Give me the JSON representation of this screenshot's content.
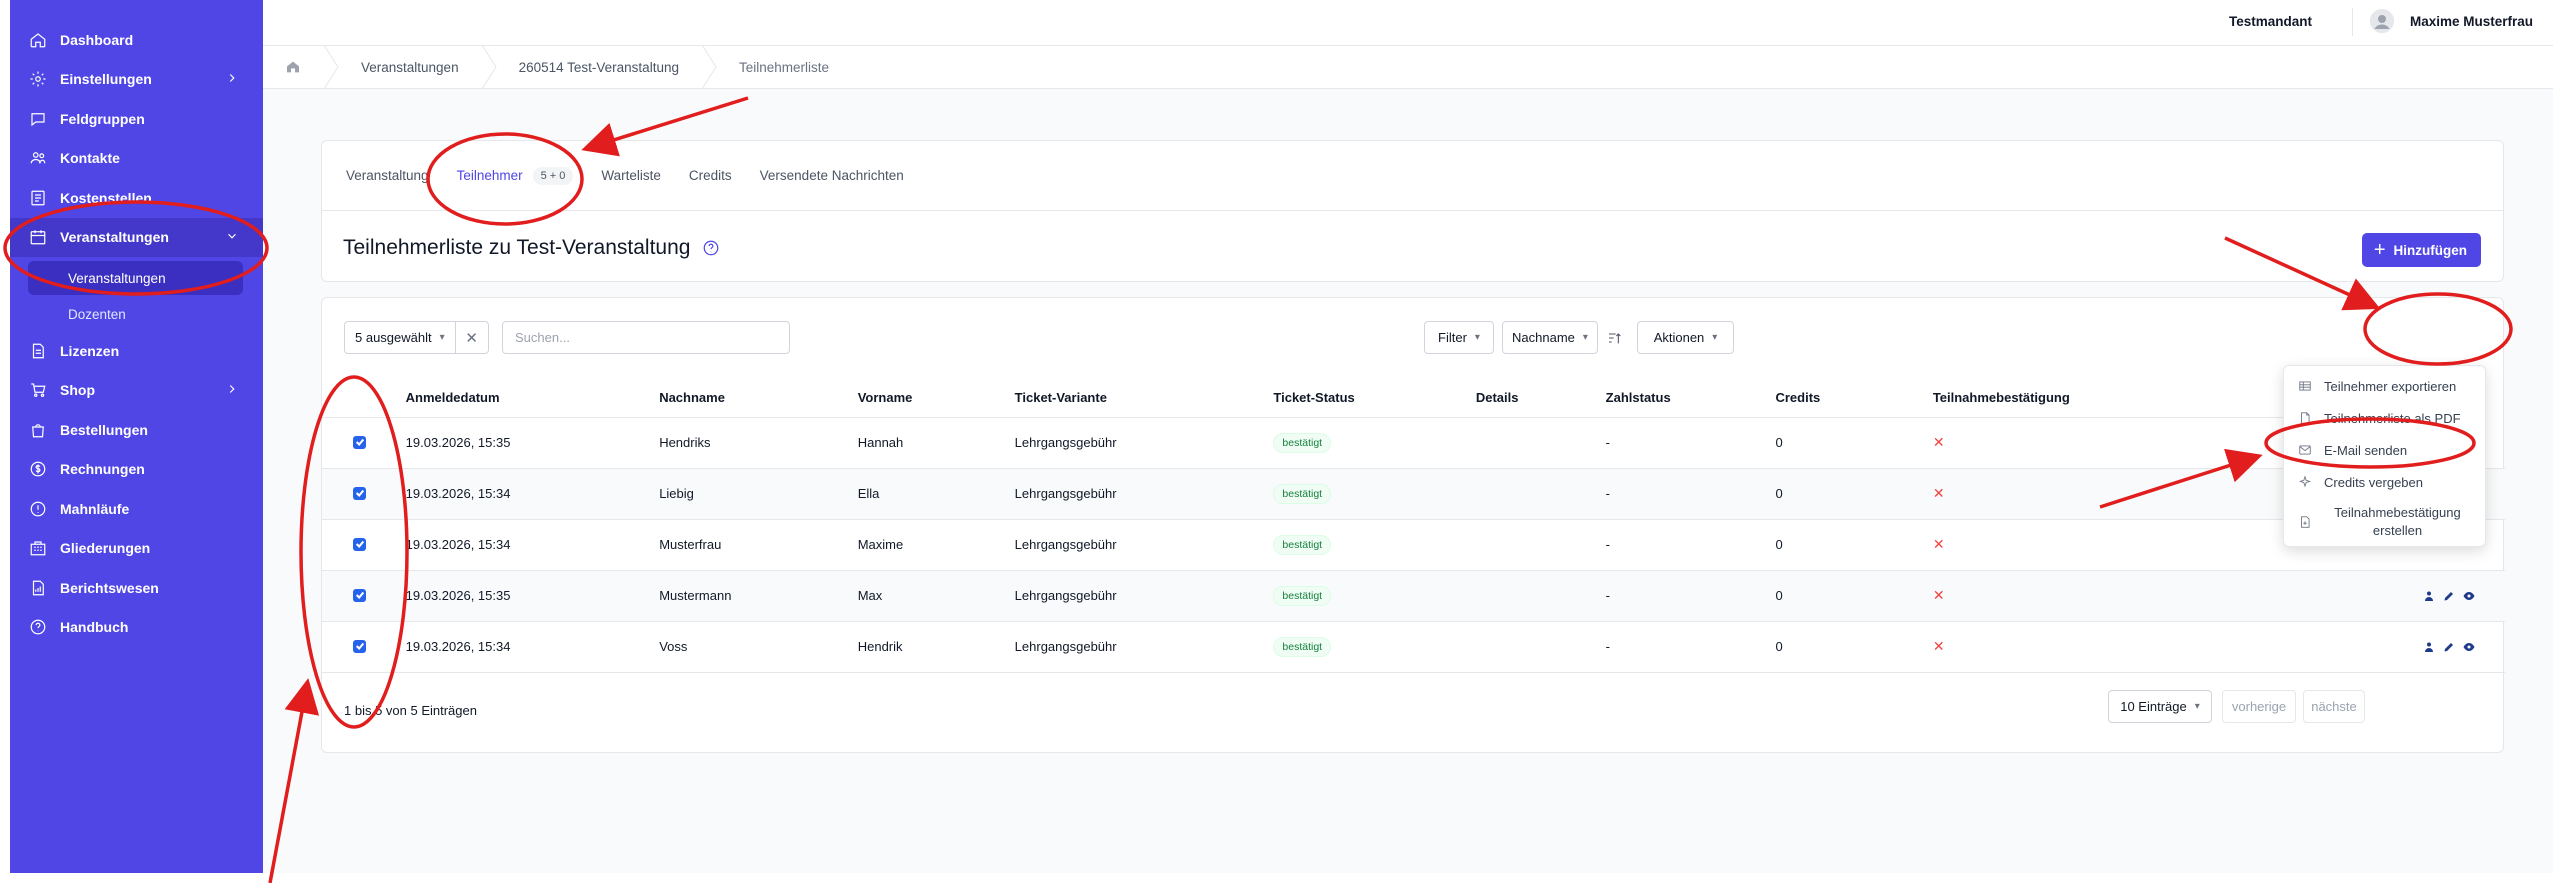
{
  "sidebar": {
    "items": [
      {
        "label": "Dashboard",
        "icon": "home-icon"
      },
      {
        "label": "Einstellungen",
        "icon": "gear-icon"
      },
      {
        "label": "Feldgruppen",
        "icon": "chat-icon"
      },
      {
        "label": "Kontakte",
        "icon": "users-icon"
      },
      {
        "label": "Kostenstellen",
        "icon": "receipt-icon"
      },
      {
        "label": "Veranstaltungen",
        "icon": "calendar-icon"
      },
      {
        "label": "Lizenzen",
        "icon": "document-icon"
      },
      {
        "label": "Shop",
        "icon": "cart-icon"
      },
      {
        "label": "Bestellungen",
        "icon": "bag-icon"
      },
      {
        "label": "Rechnungen",
        "icon": "dollar-icon"
      },
      {
        "label": "Mahnläufe",
        "icon": "alert-icon"
      },
      {
        "label": "Gliederungen",
        "icon": "building-icon"
      },
      {
        "label": "Berichtswesen",
        "icon": "report-icon"
      },
      {
        "label": "Handbuch",
        "icon": "help-icon"
      }
    ],
    "sub": {
      "selected": "Veranstaltungen",
      "other": "Dozenten"
    }
  },
  "topbar": {
    "tenant": "Testmandant",
    "user": "Maxime Musterfrau"
  },
  "breadcrumb": [
    "Veranstaltungen",
    "260514 Test-Veranstaltung",
    "Teilnehmerliste"
  ],
  "tabs": [
    {
      "label": "Veranstaltung"
    },
    {
      "label": "Teilnehmer",
      "count": "5 + 0"
    },
    {
      "label": "Warteliste"
    },
    {
      "label": "Credits"
    },
    {
      "label": "Versendete Nachrichten"
    }
  ],
  "page": {
    "title": "Teilnehmerliste zu Test-Veranstaltung",
    "add_label": "Hinzufügen"
  },
  "toolbar": {
    "selected": "5 ausgewählt",
    "search_placeholder": "Suchen...",
    "filter": "Filter",
    "sort": "Nachname",
    "actions": "Aktionen"
  },
  "table": {
    "headers": [
      "Anmeldedatum",
      "Nachname",
      "Vorname",
      "Ticket-Variante",
      "Ticket-Status",
      "Details",
      "Zahlstatus",
      "Credits",
      "Teilnahmebestätigung"
    ],
    "rows": [
      {
        "date": "19.03.2026, 15:35",
        "last": "Hendriks",
        "first": "Hannah",
        "variant": "Lehrgangsgebühr",
        "status": "bestätigt",
        "pay": "-",
        "credits": "0",
        "cert": "✕"
      },
      {
        "date": "19.03.2026, 15:34",
        "last": "Liebig",
        "first": "Ella",
        "variant": "Lehrgangsgebühr",
        "status": "bestätigt",
        "pay": "-",
        "credits": "0",
        "cert": "✕"
      },
      {
        "date": "19.03.2026, 15:34",
        "last": "Musterfrau",
        "first": "Maxime",
        "variant": "Lehrgangsgebühr",
        "status": "bestätigt",
        "pay": "-",
        "credits": "0",
        "cert": "✕"
      },
      {
        "date": "19.03.2026, 15:35",
        "last": "Mustermann",
        "first": "Max",
        "variant": "Lehrgangsgebühr",
        "status": "bestätigt",
        "pay": "-",
        "credits": "0",
        "cert": "✕"
      },
      {
        "date": "19.03.2026, 15:34",
        "last": "Voss",
        "first": "Hendrik",
        "variant": "Lehrgangsgebühr",
        "status": "bestätigt",
        "pay": "-",
        "credits": "0",
        "cert": "✕"
      }
    ],
    "info": "1 bis 5 von 5 Einträgen",
    "page_size": "10 Einträge",
    "prev": "vorherige",
    "next": "nächste"
  },
  "menu": [
    {
      "label": "Teilnehmer exportieren",
      "icon": "table-icon"
    },
    {
      "label": "Teilnehmerliste als PDF",
      "icon": "pdf-icon"
    },
    {
      "label": "E-Mail senden",
      "icon": "mail-icon"
    },
    {
      "label": "Credits vergeben",
      "icon": "sparkle-icon"
    },
    {
      "label": "Teilnahmebestätigung erstellen",
      "icon": "doc-plus-icon"
    }
  ],
  "colors": {
    "sidebar": "#5046e5",
    "accent": "#4f46e5",
    "annotation": "#e11d1d"
  }
}
